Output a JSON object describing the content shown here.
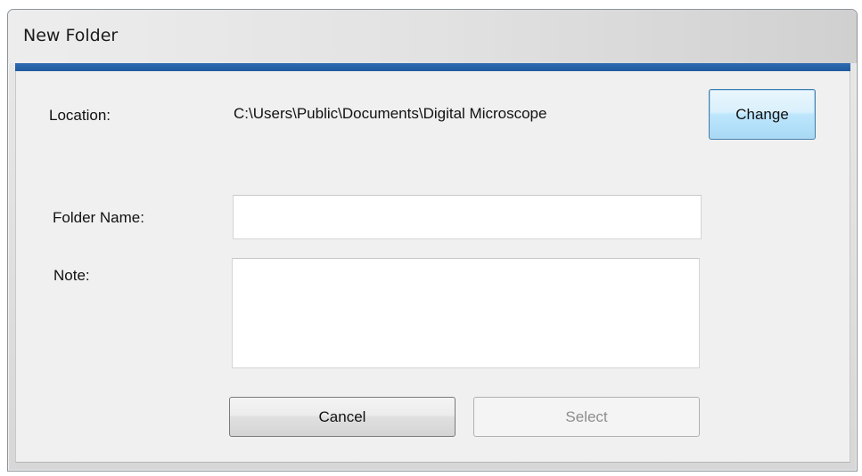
{
  "window": {
    "title": "New Folder"
  },
  "location": {
    "label": "Location:",
    "path": "C:\\Users\\Public\\Documents\\Digital Microscope",
    "change_button": "Change"
  },
  "folder_name": {
    "label": "Folder Name:",
    "value": "",
    "placeholder": ""
  },
  "note": {
    "label": "Note:",
    "value": "",
    "placeholder": ""
  },
  "actions": {
    "cancel_label": "Cancel",
    "select_label": "Select"
  },
  "colors": {
    "accent": "#2f6bb1",
    "client_background": "#f0f0f0",
    "disabled_text": "#8d8d8d"
  }
}
